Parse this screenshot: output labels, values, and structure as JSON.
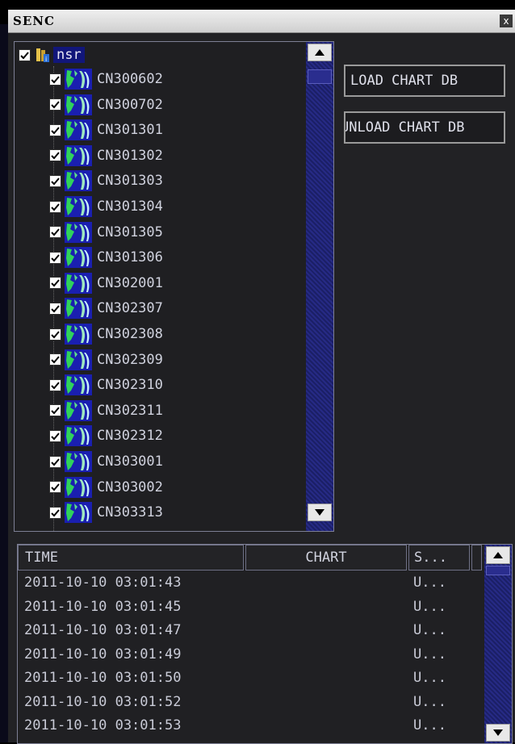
{
  "window": {
    "title": "SENC",
    "close_label": "x"
  },
  "tree": {
    "root": {
      "label": "nsr",
      "checked": true
    },
    "items": [
      {
        "label": "CN300602",
        "checked": true
      },
      {
        "label": "CN300702",
        "checked": true
      },
      {
        "label": "CN301301",
        "checked": true
      },
      {
        "label": "CN301302",
        "checked": true
      },
      {
        "label": "CN301303",
        "checked": true
      },
      {
        "label": "CN301304",
        "checked": true
      },
      {
        "label": "CN301305",
        "checked": true
      },
      {
        "label": "CN301306",
        "checked": true
      },
      {
        "label": "CN302001",
        "checked": true
      },
      {
        "label": "CN302307",
        "checked": true
      },
      {
        "label": "CN302308",
        "checked": true
      },
      {
        "label": "CN302309",
        "checked": true
      },
      {
        "label": "CN302310",
        "checked": true
      },
      {
        "label": "CN302311",
        "checked": true
      },
      {
        "label": "CN302312",
        "checked": true
      },
      {
        "label": "CN303001",
        "checked": true
      },
      {
        "label": "CN303002",
        "checked": true
      },
      {
        "label": "CN303313",
        "checked": true
      }
    ]
  },
  "buttons": {
    "load": "LOAD CHART DB",
    "unload": "UNLOAD CHART DB"
  },
  "log": {
    "columns": [
      "TIME",
      "CHART",
      "S..."
    ],
    "rows": [
      {
        "time": "2011-10-10 03:01:43",
        "chart": "",
        "status": "U..."
      },
      {
        "time": "2011-10-10 03:01:45",
        "chart": "",
        "status": "U..."
      },
      {
        "time": "2011-10-10 03:01:47",
        "chart": "",
        "status": "U..."
      },
      {
        "time": "2011-10-10 03:01:49",
        "chart": "",
        "status": "U..."
      },
      {
        "time": "2011-10-10 03:01:50",
        "chart": "",
        "status": "U..."
      },
      {
        "time": "2011-10-10 03:01:52",
        "chart": "",
        "status": "U..."
      },
      {
        "time": "2011-10-10 03:01:53",
        "chart": "",
        "status": "U..."
      }
    ]
  },
  "icons": {
    "checkbox": "checkmark-icon",
    "root": "database-icon",
    "item": "chart-map-icon",
    "scroll_up": "arrow-up-icon",
    "scroll_down": "arrow-down-icon"
  },
  "colors": {
    "background": "#222225",
    "selection": "#11167a",
    "scrollbar": "#1b1f66"
  }
}
